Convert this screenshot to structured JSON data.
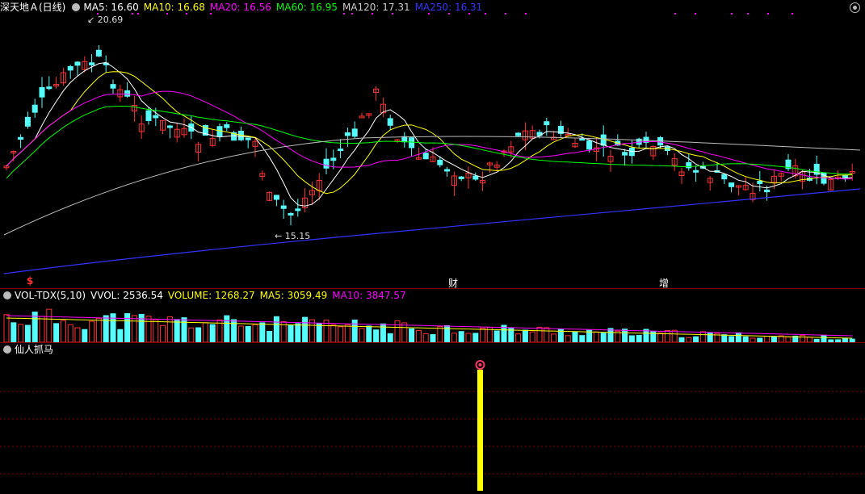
{
  "main": {
    "stock_name": "深天地Ａ(日线)",
    "ma": [
      {
        "label": "MA5: 16.60",
        "color": "#ffffff"
      },
      {
        "label": "MA10: 16.68",
        "color": "#ffff00"
      },
      {
        "label": "MA20: 16.56",
        "color": "#ff00ff"
      },
      {
        "label": "MA60: 16.95",
        "color": "#00ff00"
      },
      {
        "label": "MA120: 17.31",
        "color": "#cccccc"
      },
      {
        "label": "MA250: 16.31",
        "color": "#3333ff"
      }
    ],
    "high_label": "20.69",
    "low_label": "15.15",
    "markers": [
      {
        "text": "$",
        "color": "#ff3333"
      },
      {
        "text": "财",
        "color": "#ffffff"
      },
      {
        "text": "增",
        "color": "#ffffff"
      }
    ]
  },
  "volume": {
    "name": "VOL-TDX(5,10)",
    "vvol": "VVOL: 2536.54",
    "volume_label": "VOLUME: 1268.27",
    "ma5": "MA5: 3059.49",
    "ma10": "MA10: 3847.57"
  },
  "indicator": {
    "name": "仙人抓马"
  },
  "colors": {
    "up": "#ff3232",
    "down": "#54fcfc",
    "grid": "#8b0000",
    "signal": "#ffff00"
  }
}
